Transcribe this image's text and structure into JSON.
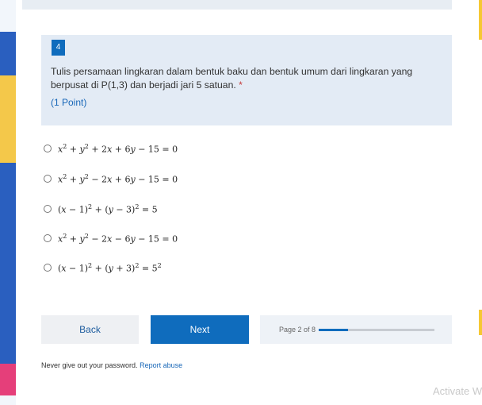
{
  "question": {
    "number": "4",
    "text": "Tulis persamaan lingkaran dalam bentuk baku dan bentuk umum dari lingkaran yang berpusat di P(1,3) dan berjadi jari 5 satuan.",
    "required_mark": "*",
    "points": "(1 Point)"
  },
  "options": [
    {
      "id": "opt1"
    },
    {
      "id": "opt2"
    },
    {
      "id": "opt3"
    },
    {
      "id": "opt4"
    },
    {
      "id": "opt5"
    }
  ],
  "buttons": {
    "back": "Back",
    "next": "Next"
  },
  "progress": {
    "label": "Page 2 of 8",
    "fraction": 0.25
  },
  "footer": {
    "text": "Never give out your password.",
    "link": "Report abuse"
  },
  "watermark": "Activate W",
  "colors": {
    "accent": "#0f6cbd",
    "question_bg": "#e3ebf5"
  }
}
